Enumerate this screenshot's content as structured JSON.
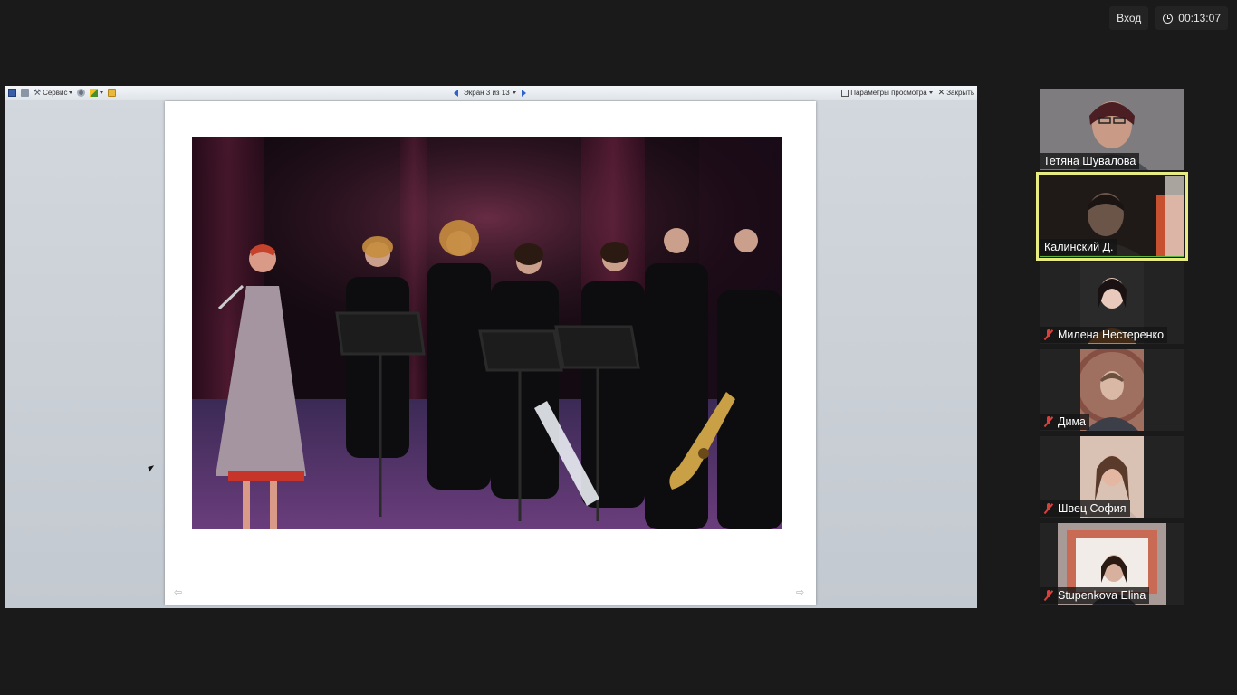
{
  "meeting": {
    "login_label": "Вход",
    "timer": "00:13:07"
  },
  "powerpoint": {
    "tools_label": "Сервис",
    "slide_counter": "Экран 3 из 13",
    "view_options_label": "Параметры просмотра",
    "close_label": "Закрыть"
  },
  "participants": [
    {
      "name": "Тетяна Шувалова",
      "muted": false,
      "active": false
    },
    {
      "name": "Калинский Д.",
      "muted": false,
      "active": true
    },
    {
      "name": "Милена Нестеренко",
      "muted": true,
      "active": false
    },
    {
      "name": "Дима",
      "muted": true,
      "active": false
    },
    {
      "name": "Швец София",
      "muted": true,
      "active": false
    },
    {
      "name": "Stupenkova Elina",
      "muted": true,
      "active": false
    }
  ],
  "colors": {
    "background": "#1a1a1a",
    "active_speaker_outline": "#e8ea82",
    "muted_mic": "#d9403a"
  }
}
